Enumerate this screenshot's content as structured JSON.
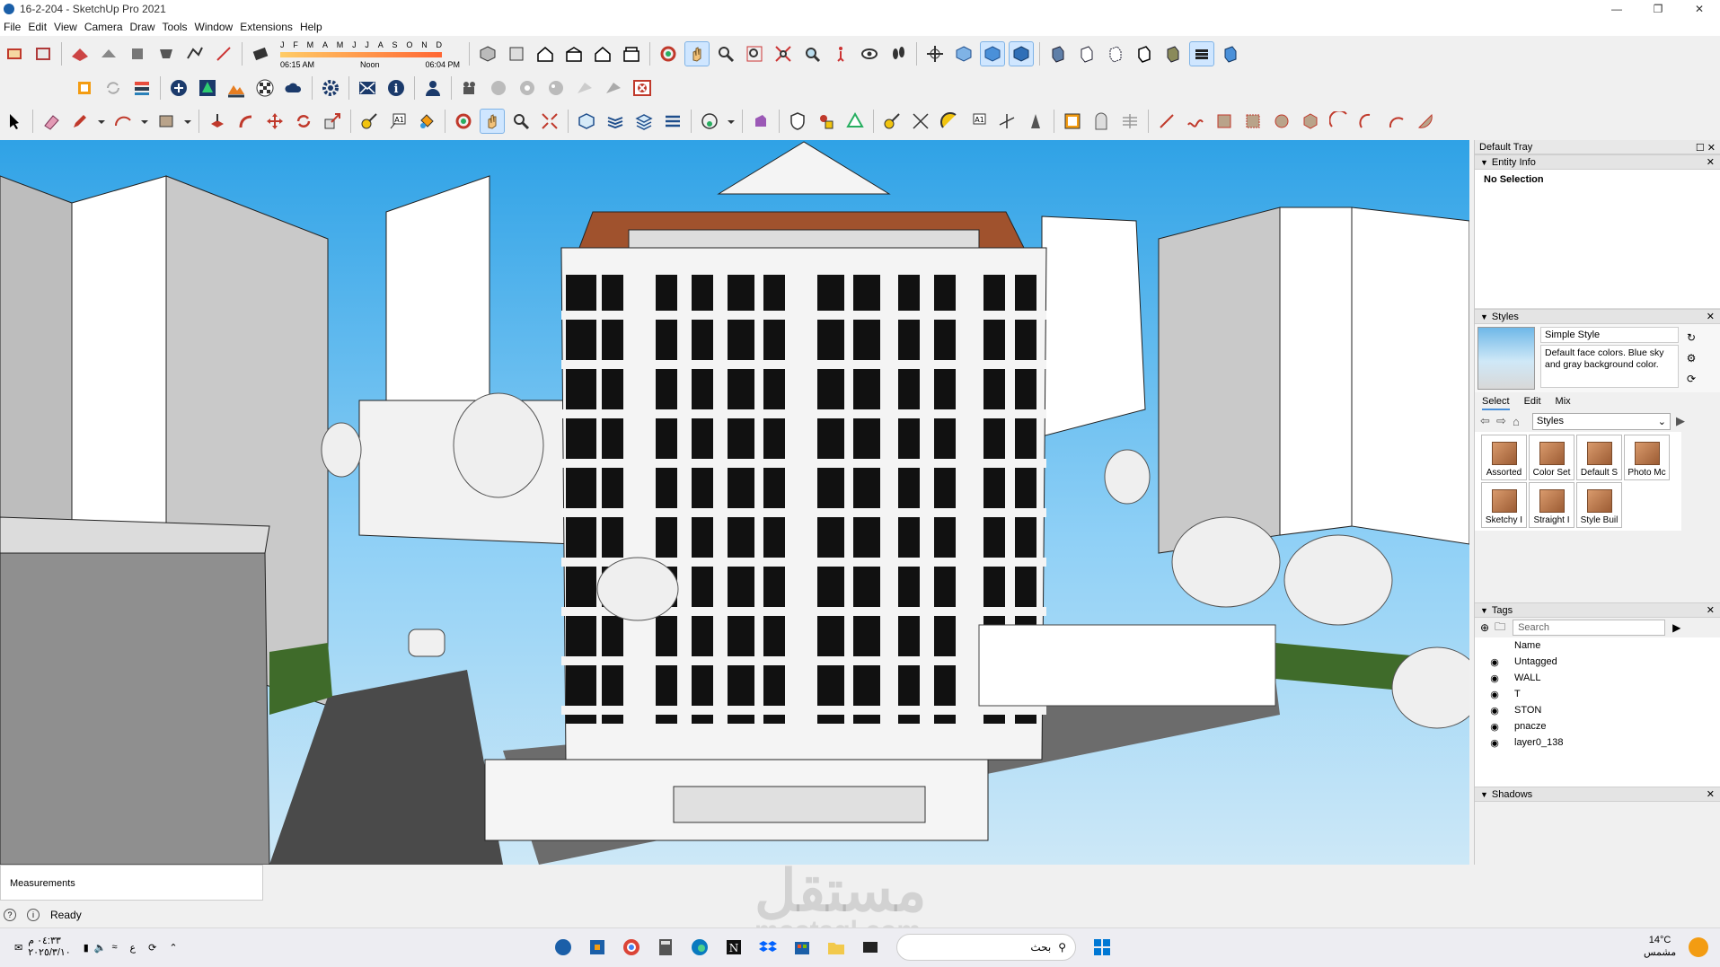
{
  "window": {
    "title": "16-2-204 - SketchUp Pro 2021"
  },
  "menu": [
    "File",
    "Edit",
    "View",
    "Camera",
    "Draw",
    "Tools",
    "Window",
    "Extensions",
    "Help"
  ],
  "shadows": {
    "months": [
      "J",
      "F",
      "M",
      "A",
      "M",
      "J",
      "J",
      "A",
      "S",
      "O",
      "N",
      "D"
    ],
    "sunrise": "06:15 AM",
    "noon": "Noon",
    "sunset": "06:04 PM"
  },
  "tray": {
    "title": "Default Tray",
    "entity_info": {
      "header": "Entity Info",
      "selection": "No Selection"
    },
    "styles": {
      "header": "Styles",
      "name": "Simple Style",
      "description": "Default face colors. Blue sky and gray background color.",
      "tabs": [
        "Select",
        "Edit",
        "Mix"
      ],
      "collection": "Styles",
      "items": [
        "Assorted",
        "Color Set",
        "Default S",
        "Photo Mc",
        "Sketchy I",
        "Straight I",
        "Style Buil"
      ]
    },
    "tags": {
      "header": "Tags",
      "search_placeholder": "Search",
      "column_name": "Name",
      "items": [
        "Untagged",
        "WALL",
        "T",
        "STON",
        "pnacze",
        "layer0_138"
      ]
    },
    "shadows_header": "Shadows"
  },
  "status": {
    "measurements": "Measurements",
    "ready": "Ready"
  },
  "taskbar": {
    "time": "٠٤:٣٣ م",
    "date": "٢٠٢٥/٣/١٠",
    "lang": "ع",
    "search": "بحث",
    "temp": "14°C",
    "weather": "مشمس"
  },
  "watermark": {
    "arabic": "مستقل",
    "latin": "mostaql.com"
  },
  "colors": {
    "sky": "#2fa2e6",
    "accent": "#4a90d9",
    "roof": "#a0522d"
  }
}
